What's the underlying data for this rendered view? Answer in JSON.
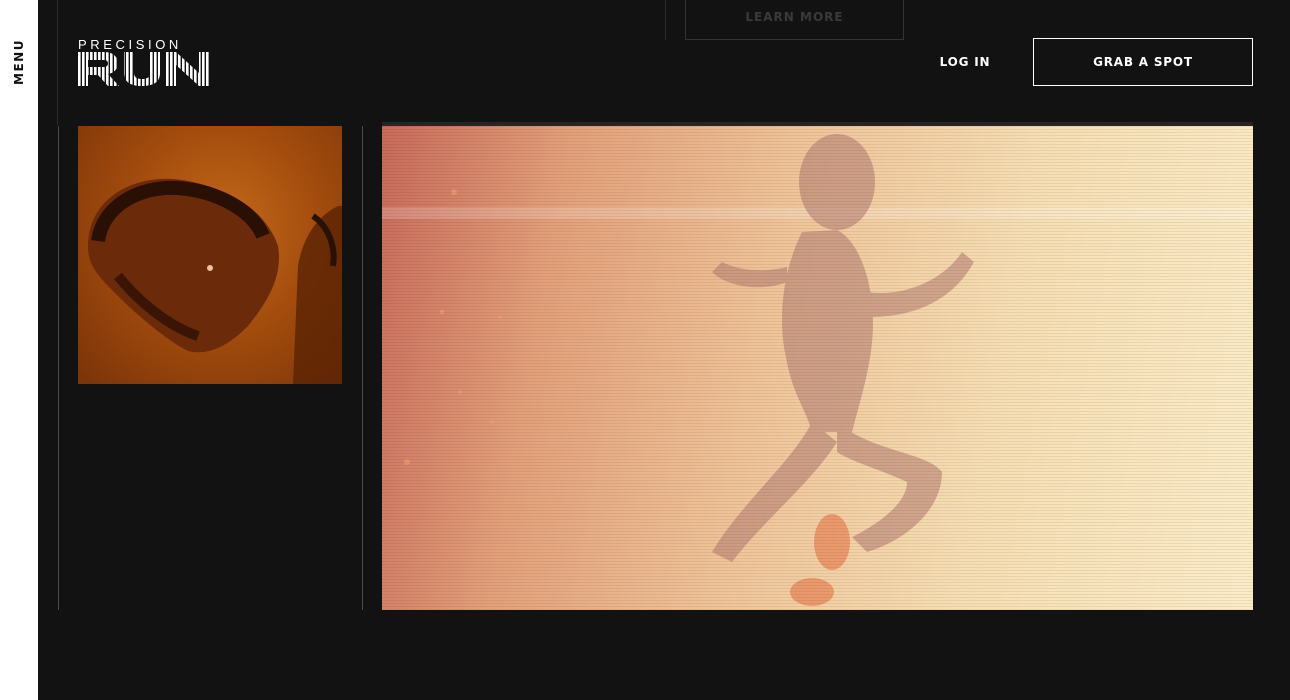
{
  "sidebar": {
    "menu_label": "MENU"
  },
  "brand": {
    "top_text": "PRECISION",
    "main_text": "RUN"
  },
  "header": {
    "learn_more_label": "LEARN MORE",
    "login_label": "LOG IN",
    "cta_label": "GRAB A SPOT"
  },
  "colors": {
    "background": "#121212",
    "sidebar": "#ffffff",
    "text": "#ffffff"
  }
}
